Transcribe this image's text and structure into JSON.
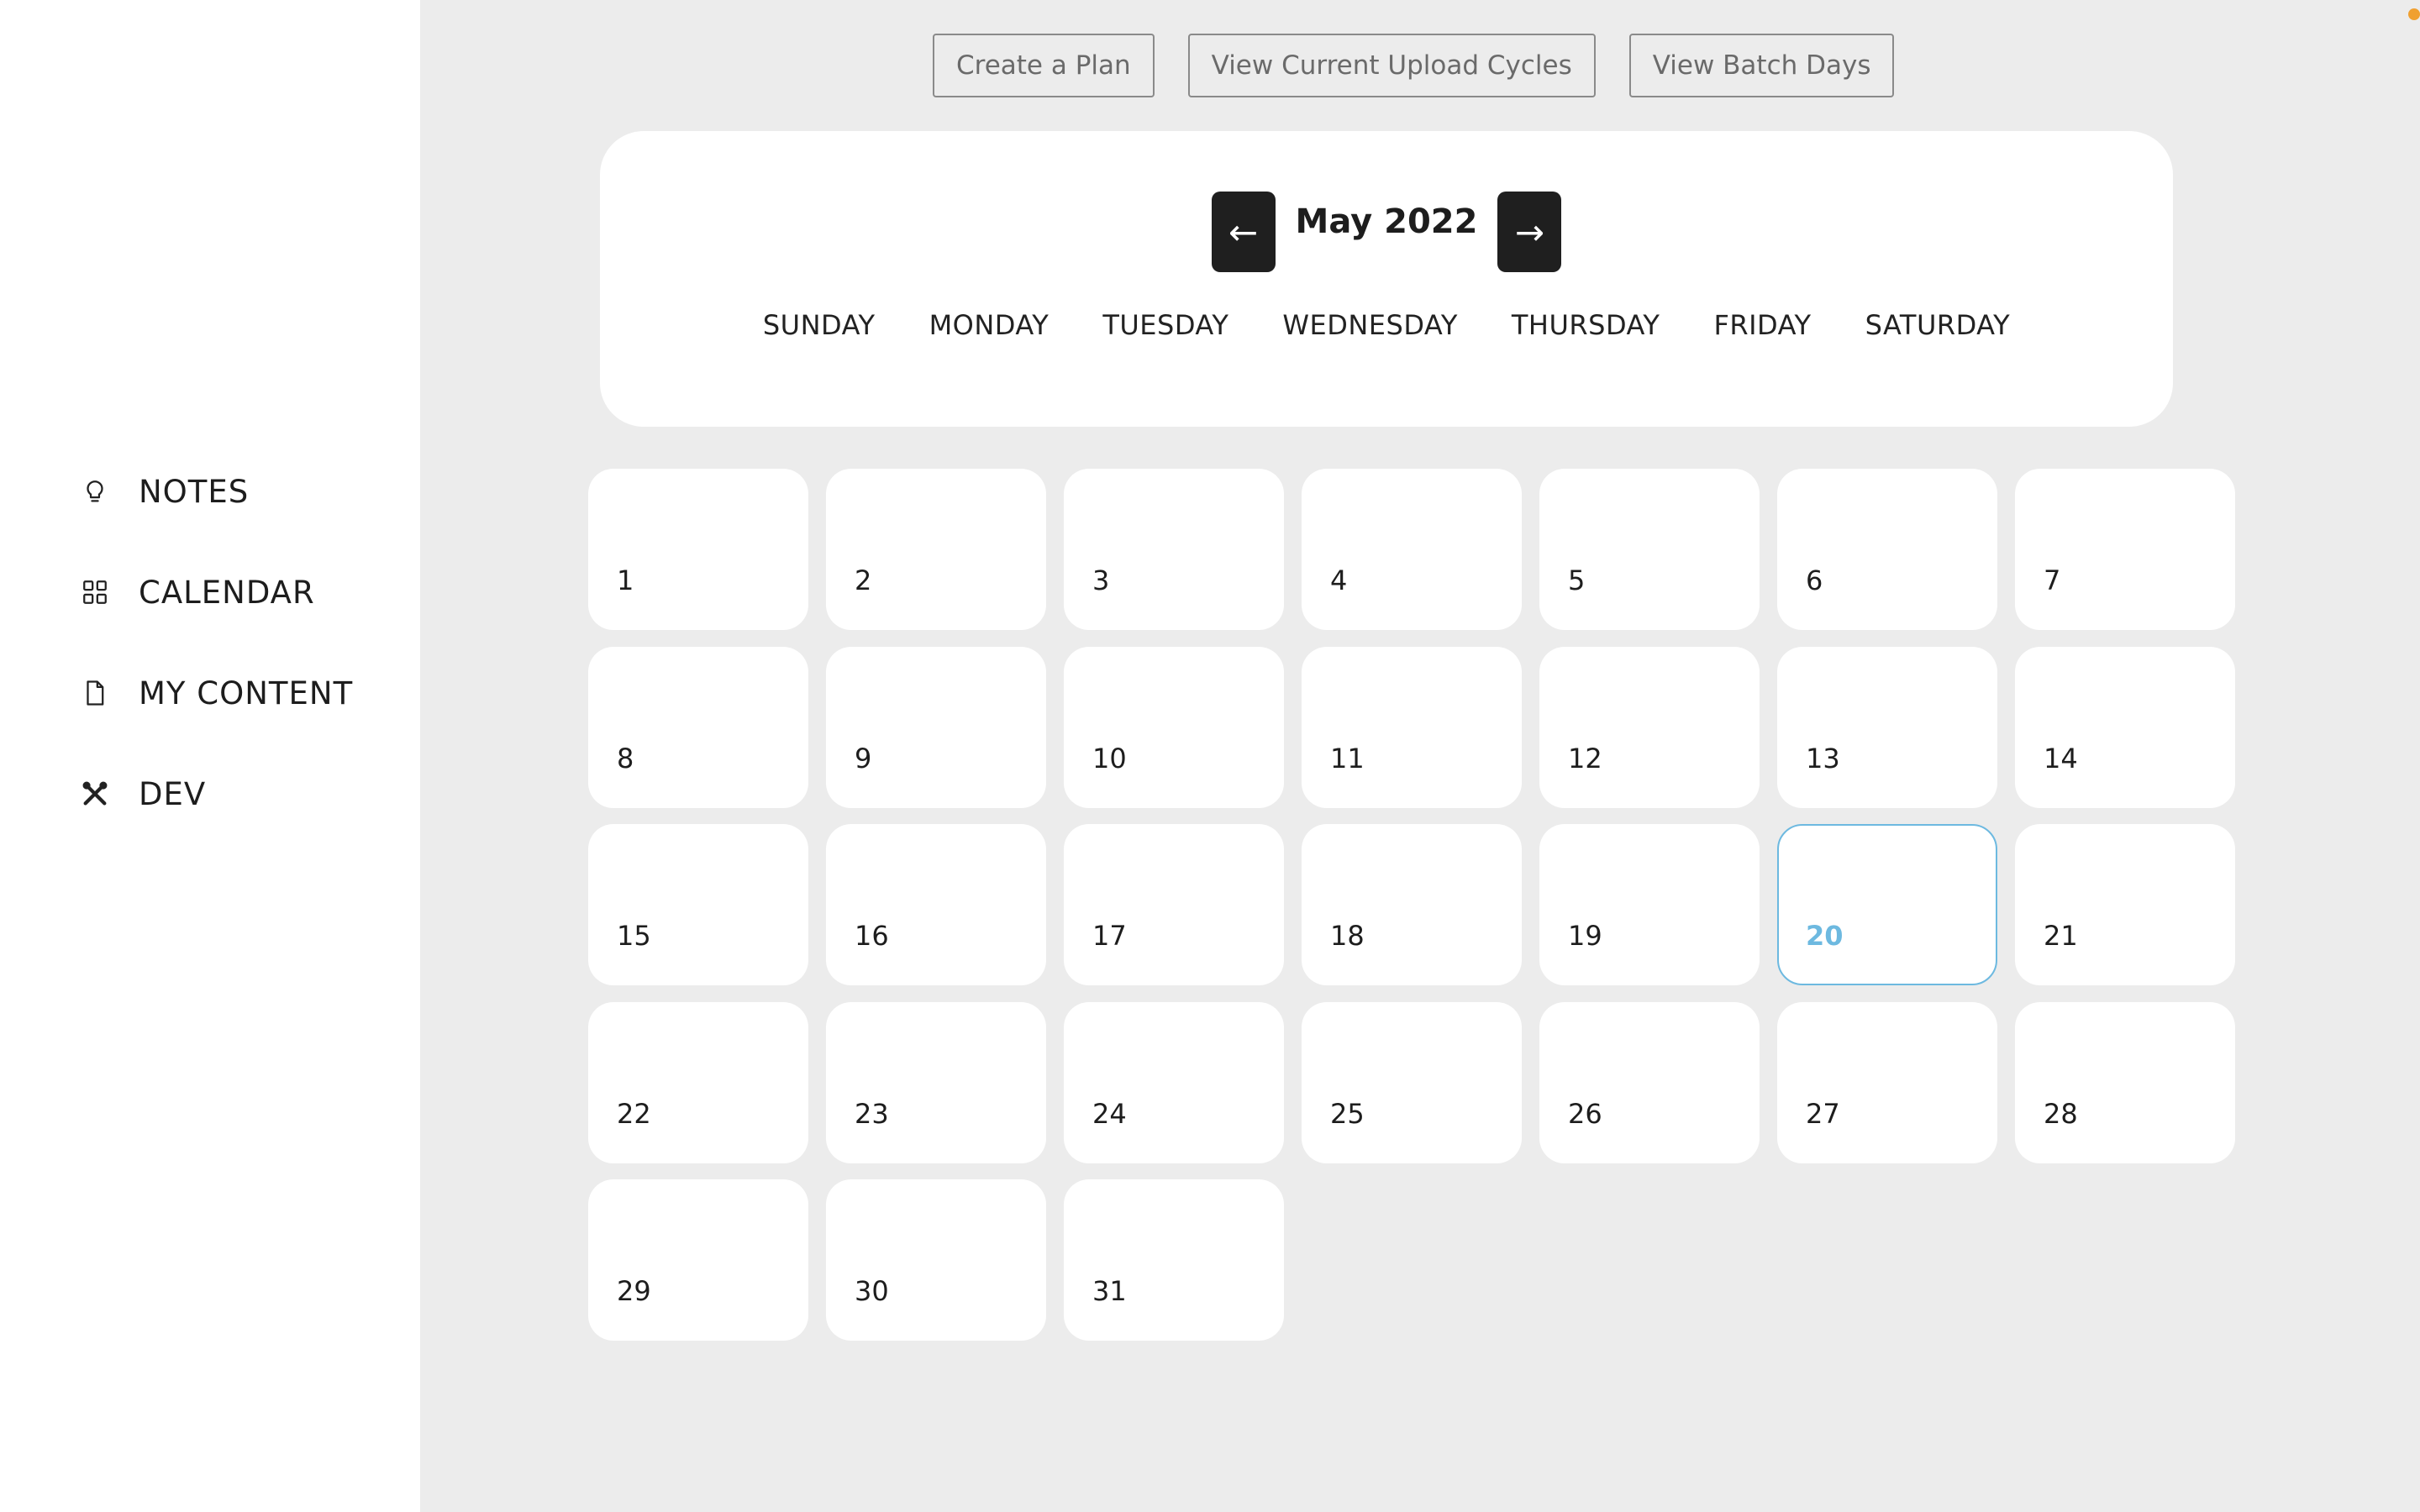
{
  "sidebar": {
    "items": [
      {
        "label": "NOTES",
        "icon": "lightbulb-icon"
      },
      {
        "label": "CALENDAR",
        "icon": "grid-icon"
      },
      {
        "label": "MY CONTENT",
        "icon": "document-icon"
      },
      {
        "label": "DEV",
        "icon": "tools-icon"
      }
    ]
  },
  "toolbar": {
    "create_plan": "Create a Plan",
    "view_upload_cycles": "View Current Upload Cycles",
    "view_batch_days": "View Batch Days"
  },
  "calendar": {
    "month_label": "May 2022",
    "prev_arrow": "←",
    "next_arrow": "→",
    "weekdays": [
      "SUNDAY",
      "MONDAY",
      "TUESDAY",
      "WEDNESDAY",
      "THURSDAY",
      "FRIDAY",
      "SATURDAY"
    ],
    "days": [
      "1",
      "2",
      "3",
      "4",
      "5",
      "6",
      "7",
      "8",
      "9",
      "10",
      "11",
      "12",
      "13",
      "14",
      "15",
      "16",
      "17",
      "18",
      "19",
      "20",
      "21",
      "22",
      "23",
      "24",
      "25",
      "26",
      "27",
      "28",
      "29",
      "30",
      "31"
    ],
    "selected_day": "20",
    "highlight_color": "#6db9e0"
  }
}
